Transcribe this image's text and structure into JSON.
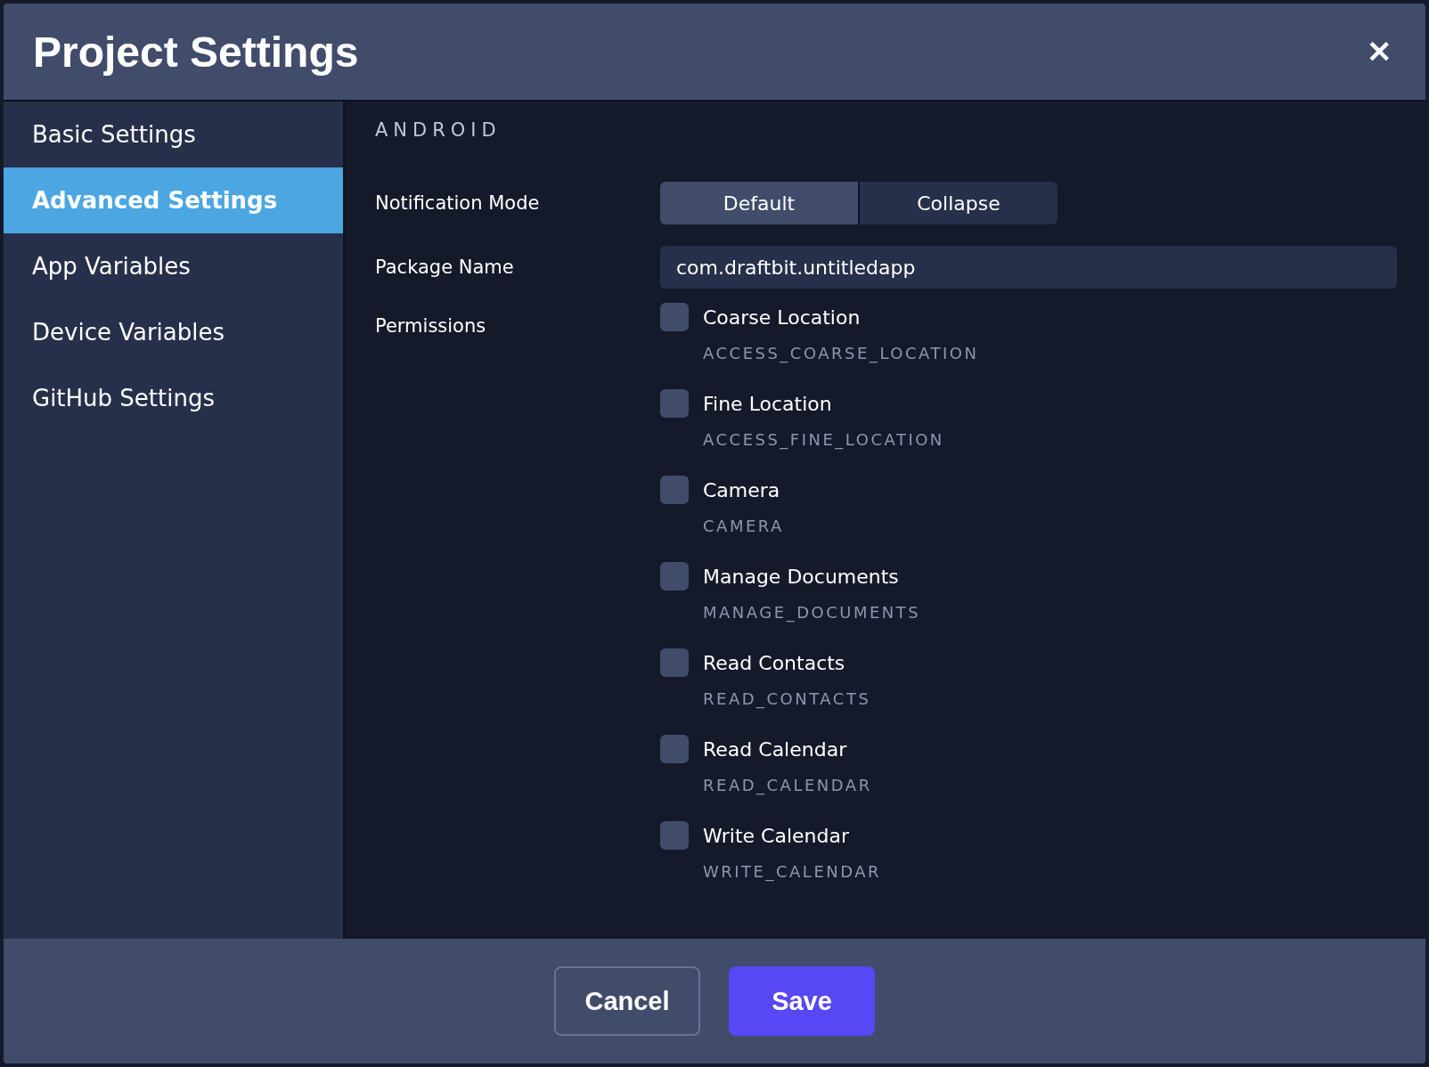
{
  "window": {
    "title": "Project Settings",
    "close": "✕"
  },
  "sidebar": {
    "items": [
      {
        "label": "Basic Settings",
        "selected": false
      },
      {
        "label": "Advanced Settings",
        "selected": true
      },
      {
        "label": "App Variables",
        "selected": false
      },
      {
        "label": "Device Variables",
        "selected": false
      },
      {
        "label": "GitHub Settings",
        "selected": false
      }
    ]
  },
  "section": "ANDROID",
  "notification_mode": {
    "label": "Notification Mode",
    "options": [
      {
        "label": "Default",
        "selected": true
      },
      {
        "label": "Collapse",
        "selected": false
      }
    ]
  },
  "package_name": {
    "label": "Package Name",
    "value": "com.draftbit.untitledapp"
  },
  "permissions": {
    "label": "Permissions",
    "items": [
      {
        "name": "Coarse Location",
        "code": "ACCESS_COARSE_LOCATION",
        "checked": false
      },
      {
        "name": "Fine Location",
        "code": "ACCESS_FINE_LOCATION",
        "checked": false
      },
      {
        "name": "Camera",
        "code": "CAMERA",
        "checked": false
      },
      {
        "name": "Manage Documents",
        "code": "MANAGE_DOCUMENTS",
        "checked": false
      },
      {
        "name": "Read Contacts",
        "code": "READ_CONTACTS",
        "checked": false
      },
      {
        "name": "Read Calendar",
        "code": "READ_CALENDAR",
        "checked": false
      },
      {
        "name": "Write Calendar",
        "code": "WRITE_CALENDAR",
        "checked": false
      }
    ]
  },
  "buttons": [
    {
      "label": "Cancel",
      "kind": "secondary"
    },
    {
      "label": "Save",
      "kind": "primary"
    }
  ]
}
